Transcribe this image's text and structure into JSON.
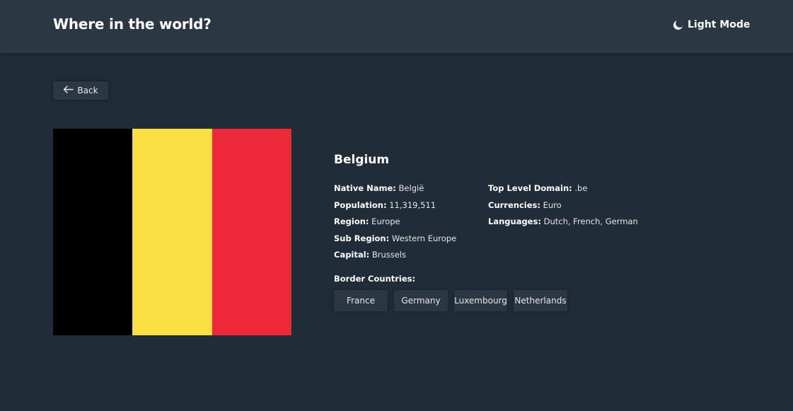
{
  "header": {
    "title": "Where in the world?",
    "mode_label": "Light Mode",
    "mode_icon": "moon-icon"
  },
  "back_button": {
    "label": "Back",
    "icon": "arrow-left-icon"
  },
  "country": {
    "name": "Belgium",
    "flag_colors": [
      "#000000",
      "#fae042",
      "#ed2939"
    ],
    "details_left": [
      {
        "key": "Native Name:",
        "value": "België"
      },
      {
        "key": "Population:",
        "value": "11,319,511"
      },
      {
        "key": "Region:",
        "value": "Europe"
      },
      {
        "key": "Sub Region:",
        "value": "Western Europe"
      },
      {
        "key": "Capital:",
        "value": "Brussels"
      }
    ],
    "details_right": [
      {
        "key": "Top Level Domain:",
        "value": ".be"
      },
      {
        "key": "Currencies:",
        "value": "Euro"
      },
      {
        "key": "Languages:",
        "value": "Dutch, French, German"
      }
    ],
    "border_label": "Border Countries:",
    "borders": [
      "France",
      "Germany",
      "Luxembourg",
      "Netherlands"
    ]
  },
  "colors": {
    "background": "#202c37",
    "element": "#2b3743",
    "text": "#ffffff"
  }
}
